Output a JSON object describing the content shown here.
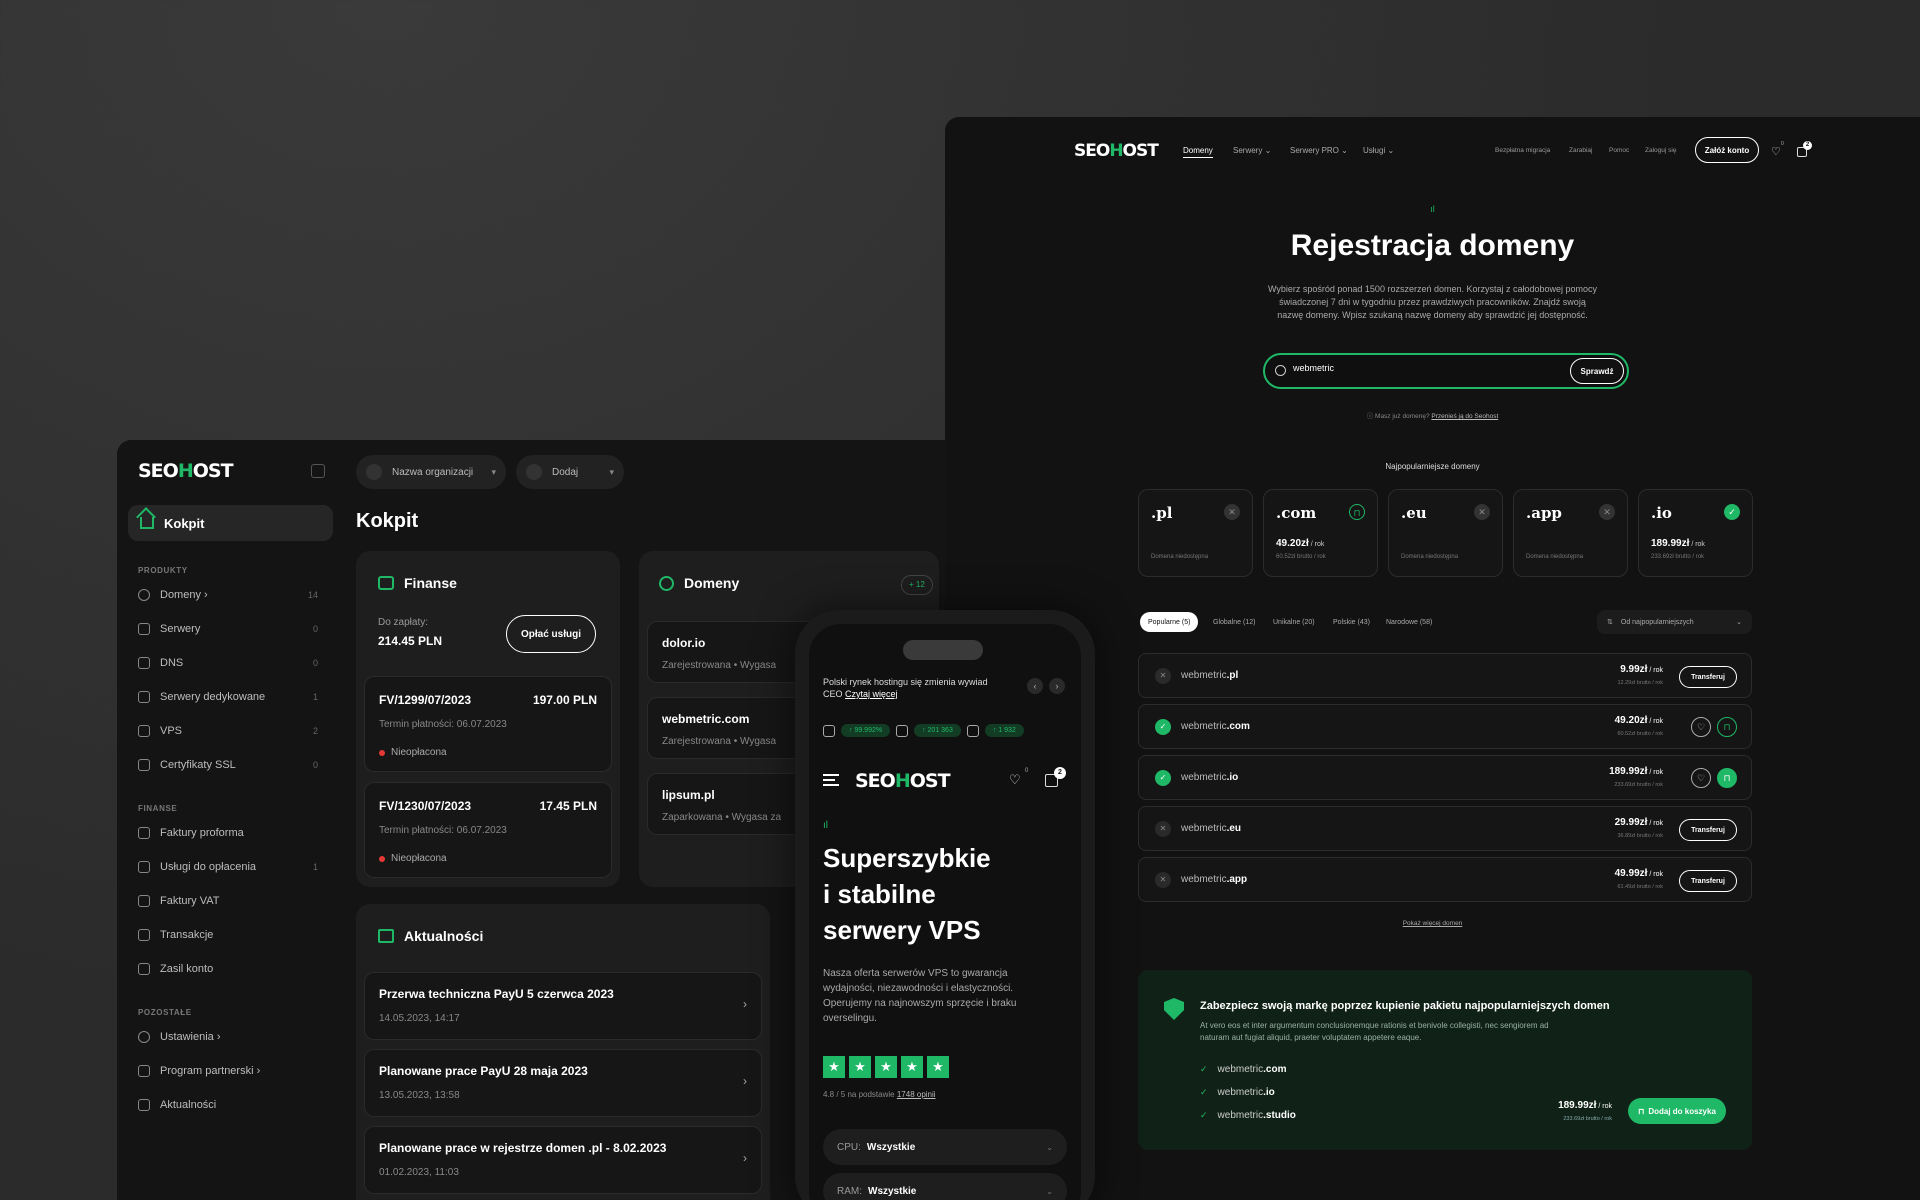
{
  "dashboard": {
    "logo": {
      "pre": "SEO",
      "h": "H",
      "post": "OST"
    },
    "active_item": "Kokpit",
    "sections": {
      "produkty": "PRODUKTY",
      "finanse": "FINANSE",
      "pozostale": "POZOSTAŁE"
    },
    "produkty_items": [
      {
        "label": "Domeny ›",
        "count": "14"
      },
      {
        "label": "Serwery",
        "count": "0"
      },
      {
        "label": "DNS",
        "count": "0"
      },
      {
        "label": "Serwery dedykowane",
        "count": "1"
      },
      {
        "label": "VPS",
        "count": "2"
      },
      {
        "label": "Certyfikaty SSL",
        "count": "0"
      }
    ],
    "finanse_items": [
      {
        "label": "Faktury proforma",
        "count": ""
      },
      {
        "label": "Usługi do opłacenia",
        "count": "1"
      },
      {
        "label": "Faktury VAT",
        "count": ""
      },
      {
        "label": "Transakcje",
        "count": ""
      },
      {
        "label": "Zasil konto",
        "count": ""
      }
    ],
    "pozostale_items": [
      {
        "label": "Ustawienia ›",
        "count": ""
      },
      {
        "label": "Program partnerski ›",
        "count": ""
      },
      {
        "label": "Aktualności",
        "count": ""
      }
    ],
    "org_select": "Nazwa organizacji",
    "add_select": "Dodaj",
    "page_title": "Kokpit",
    "finance": {
      "title": "Finanse",
      "due_label": "Do zapłaty:",
      "due_amount": "214.45 PLN",
      "pay_button": "Opłać usługi",
      "invoices": [
        {
          "no": "FV/1299/07/2023",
          "amount": "197.00 PLN",
          "due": "Termin płatności: 06.07.2023",
          "status": "Nieopłacona"
        },
        {
          "no": "FV/1230/07/2023",
          "amount": "17.45 PLN",
          "due": "Termin płatności: 06.07.2023",
          "status": "Nieopłacona"
        }
      ]
    },
    "domains": {
      "title": "Domeny",
      "badge": "+ 12",
      "items": [
        {
          "name": "dolor.io",
          "status": "Zarejestrowana  •  Wygasa"
        },
        {
          "name": "webmetric.com",
          "status": "Zarejestrowana  •  Wygasa"
        },
        {
          "name": "lipsum.pl",
          "status": "Zaparkowana  •  Wygasa za"
        }
      ]
    },
    "news": {
      "title": "Aktualności",
      "items": [
        {
          "title": "Przerwa techniczna PayU 5 czerwca 2023",
          "date": "14.05.2023, 14:17"
        },
        {
          "title": "Planowane prace PayU 28 maja 2023",
          "date": "13.05.2023, 13:58"
        },
        {
          "title": "Planowane prace w rejestrze domen .pl - 8.02.2023",
          "date": "01.02.2023, 11:03"
        }
      ]
    }
  },
  "site": {
    "nav": [
      "Domeny",
      "Serwery ⌄",
      "Serwery PRO ⌄",
      "Usługi ⌄"
    ],
    "nav_right": [
      "Bezpłatna migracja",
      "Zarabiaj",
      "Pomoc",
      "Zaloguj się"
    ],
    "signup": "Załóż konto",
    "heart_count": "0",
    "cart_count": "2",
    "hero_title": "Rejestracja domeny",
    "hero_desc": "Wybierz spośród ponad 1500 rozszerzeń domen. Korzystaj z całodobowej pomocy świadczonej 7 dni w tygodniu przez prawdziwych pracowników. Znajdź swoją nazwę domeny. Wpisz szukaną nazwę domeny aby sprawdzić jej dostępność.",
    "search_value": "webmetric",
    "search_button": "Sprawdź",
    "has_domain": "Masz już domenę?",
    "transfer_link": "Przenieś ją do Seohost",
    "popular_title": "Najpopularniejsze domeny",
    "tlds": [
      {
        "ext": ".pl",
        "state": "x",
        "price": "",
        "unit": "",
        "sub": "Domena niedostępna"
      },
      {
        "ext": ".com",
        "state": "bag",
        "price": "49.20zł",
        "unit": " / rok",
        "sub": "60.52zł brutto / rok"
      },
      {
        "ext": ".eu",
        "state": "x",
        "price": "",
        "unit": "",
        "sub": "Domena niedostępna"
      },
      {
        "ext": ".app",
        "state": "x",
        "price": "",
        "unit": "",
        "sub": "Domena niedostępna"
      },
      {
        "ext": ".io",
        "state": "ok",
        "price": "189.99zł",
        "unit": " / rok",
        "sub": "233.69zł brutto / rok"
      }
    ],
    "filters": [
      "Popularne (5)",
      "Globalne (12)",
      "Unikalne (20)",
      "Polskie (43)",
      "Narodowe (58)"
    ],
    "sort": "Od najpopularniejszych",
    "results": [
      {
        "base": "webmetric",
        "ext": ".pl",
        "ok": false,
        "price": "9.99zł",
        "unit": " / rok",
        "sub": "12.29zł brutto / rok",
        "action": "Transferuj"
      },
      {
        "base": "webmetric",
        "ext": ".com",
        "ok": true,
        "price": "49.20zł",
        "unit": " / rok",
        "sub": "60.52zł brutto / rok",
        "action": ""
      },
      {
        "base": "webmetric",
        "ext": ".io",
        "ok": true,
        "price": "189.99zł",
        "unit": " / rok",
        "sub": "233.69zł brutto / rok",
        "action": ""
      },
      {
        "base": "webmetric",
        "ext": ".eu",
        "ok": false,
        "price": "29.99zł",
        "unit": " / rok",
        "sub": "36.89zł brutto / rok",
        "action": "Transferuj"
      },
      {
        "base": "webmetric",
        "ext": ".app",
        "ok": false,
        "price": "49.99zł",
        "unit": " / rok",
        "sub": "61.49zł brutto / rok",
        "action": "Transferuj"
      }
    ],
    "show_more": "Pokaż więcej domen",
    "bundle": {
      "title": "Zabezpiecz swoją markę poprzez kupienie pakietu najpopularniejszych domen",
      "desc": "At vero eos et inter argumentum conclusionemque rationis et benivole collegisti, nec sengiorem ad naturam aut fugiat aliquid, praeter voluptatem appetere eaque.",
      "items": [
        {
          "base": "webmetric",
          "ext": ".com"
        },
        {
          "base": "webmetric",
          "ext": ".io"
        },
        {
          "base": "webmetric",
          "ext": ".studio"
        }
      ],
      "price": "189.99zł",
      "unit": " / rok",
      "sub": "233.69zł brutto / rok",
      "add_button": "Dodaj do koszyka"
    }
  },
  "phone": {
    "ticker_text": "Polski rynek hostingu się zmienia wywiad CEO",
    "ticker_link": "Czytaj więcej",
    "stats": [
      "↑ 99.992%",
      "↑ 201 363",
      "↑ 1 932"
    ],
    "heart_count": "0",
    "cart_count": "2",
    "title_lines": [
      "Superszybkie",
      "i stabilne",
      "serwery VPS"
    ],
    "desc": "Nasza oferta serwerów VPS to gwarancja wydajności, niezawodności i elastyczności. Operujemy na najnowszym sprzęcie i braku overselingu.",
    "rating_text": "4.8 / 5 na podstawie",
    "rating_link": "1748 opinii",
    "cpu_label": "CPU:",
    "cpu_value": "Wszystkie",
    "ram_label": "RAM:",
    "ram_value": "Wszystkie"
  }
}
